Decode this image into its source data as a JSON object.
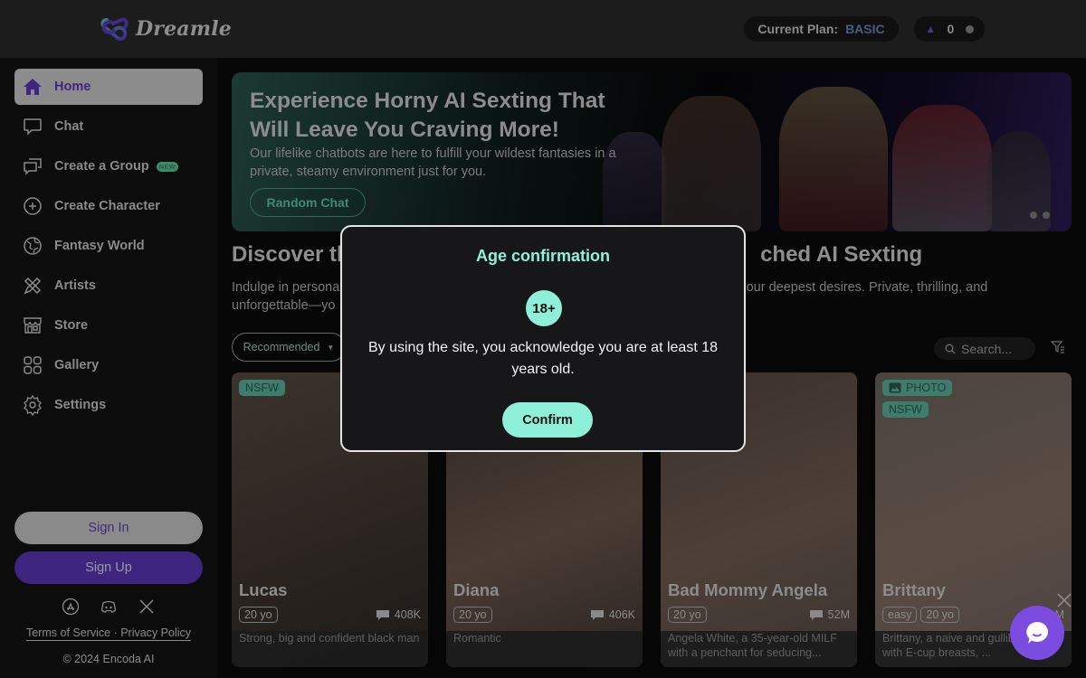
{
  "header": {
    "brand": "Dreamle",
    "plan_label": "Current Plan:",
    "plan_value": "BASIC",
    "credits": "0",
    "credits_icon": "flame-icon",
    "add_credits_icon": "plus-circle-icon"
  },
  "sidebar": {
    "items": [
      {
        "label": "Home",
        "icon": "home-icon",
        "active": true
      },
      {
        "label": "Chat",
        "icon": "chat-bubble-icon"
      },
      {
        "label": "Create a Group",
        "icon": "group-chat-icon",
        "badge": "NEW"
      },
      {
        "label": "Create Character",
        "icon": "plus-circle-icon"
      },
      {
        "label": "Fantasy World",
        "icon": "globe-icon"
      },
      {
        "label": "Artists",
        "icon": "pencil-ruler-icon"
      },
      {
        "label": "Store",
        "icon": "store-icon"
      },
      {
        "label": "Gallery",
        "icon": "grid-icon"
      },
      {
        "label": "Settings",
        "icon": "gear-icon"
      }
    ],
    "sign_in": "Sign In",
    "sign_up": "Sign Up",
    "social": [
      "app-store-icon",
      "discord-icon",
      "x-icon"
    ],
    "terms": "Terms of Service",
    "separator": " · ",
    "privacy": "Privacy Policy",
    "copyright": "© 2024 Encoda AI"
  },
  "hero": {
    "title": "Experience Horny AI Sexting That Will Leave You Craving More!",
    "subtitle": "Our lifelike chatbots are here to fulfill your wildest fantasies in a private, steamy environment just for you.",
    "button": "Random Chat",
    "slides": 2
  },
  "section": {
    "title_left": "Discover th",
    "title_right": "ched AI Sexting",
    "desc_left_line1": "Indulge in persona",
    "desc_left_line2": "unforgettable—yo",
    "desc_right": "your deepest desires. Private, thrilling, and"
  },
  "toolbar": {
    "sort_selected": "Recommended",
    "search_placeholder": "Search...",
    "filter_icon": "filter-icon"
  },
  "cards": [
    {
      "name": "Lucas",
      "tags_top": [
        "NSFW"
      ],
      "pills": [
        "20 yo"
      ],
      "count": "408K",
      "desc": "Strong, big and confident black man"
    },
    {
      "name": "Diana",
      "tags_top": [],
      "pills": [
        "20 yo"
      ],
      "count": "406K",
      "desc": "Romantic"
    },
    {
      "name": "Bad Mommy Angela",
      "tags_top": [],
      "pills": [
        "20 yo"
      ],
      "count": "52M",
      "desc": "Angela White, a 35-year-old MILF with a penchant for seducing..."
    },
    {
      "name": "Brittany",
      "tags_top": [
        "PHOTO",
        "NSFW"
      ],
      "pills": [
        "easy",
        "20 yo"
      ],
      "count": "M",
      "desc": "Brittany, a naive and gullible beauty with E-cup breasts, ..."
    }
  ],
  "modal": {
    "title": "Age confirmation",
    "badge": "18+",
    "text": "By using the site, you acknowledge you are at least 18 years old.",
    "confirm": "Confirm"
  },
  "chat_widget": {
    "close_icon": "close-icon",
    "launcher_icon": "chat-launcher-icon"
  },
  "colors": {
    "accent_mint": "#8ff0da",
    "brand_purple": "#3e2580",
    "chat_purple": "#7c4be0",
    "nsfw_tag": "#3f7c6c"
  }
}
